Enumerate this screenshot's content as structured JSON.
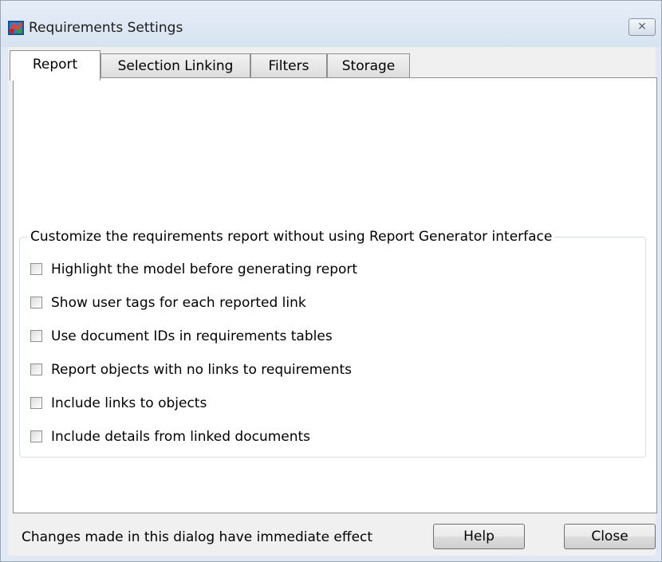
{
  "window": {
    "title": "Requirements Settings",
    "close_glyph": "⨯",
    "app_icon": "simulink-icon"
  },
  "tabs": [
    {
      "label": "Report",
      "active": true
    },
    {
      "label": "Selection Linking",
      "active": false
    },
    {
      "label": "Filters",
      "active": false
    },
    {
      "label": "Storage",
      "active": false
    }
  ],
  "report_group": {
    "legend": "Customize the requirements report without using Report Generator interface",
    "options": [
      {
        "label": "Highlight the model before generating report",
        "checked": false
      },
      {
        "label": "Show user tags for each reported link",
        "checked": false
      },
      {
        "label": "Use document IDs in requirements tables",
        "checked": false
      },
      {
        "label": "Report objects with no links to requirements",
        "checked": false
      },
      {
        "label": "Include links to objects",
        "checked": false
      },
      {
        "label": "Include details from linked documents",
        "checked": false
      }
    ]
  },
  "footer": {
    "status": "Changes made in this dialog have immediate effect",
    "help_label": "Help",
    "close_label": "Close"
  }
}
